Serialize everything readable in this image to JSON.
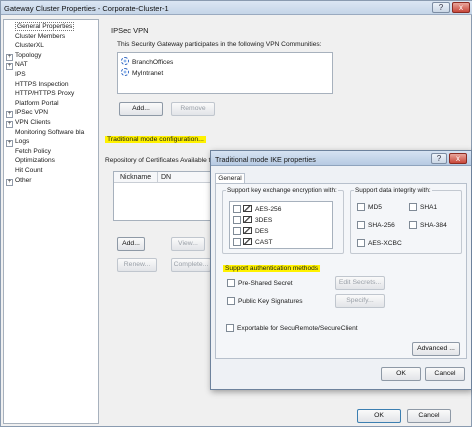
{
  "window": {
    "title": "Gateway Cluster Properties - Corporate-Cluster-1",
    "help": "?",
    "close": "x"
  },
  "tree": [
    {
      "label": "General Properties",
      "exp": "",
      "sel": true
    },
    {
      "label": "Cluster Members",
      "exp": ""
    },
    {
      "label": "ClusterXL",
      "exp": ""
    },
    {
      "label": "Topology",
      "exp": "+"
    },
    {
      "label": "NAT",
      "exp": "+"
    },
    {
      "label": "IPS",
      "exp": ""
    },
    {
      "label": "HTTPS Inspection",
      "exp": ""
    },
    {
      "label": "HTTP/HTTPS Proxy",
      "exp": ""
    },
    {
      "label": "Platform Portal",
      "exp": ""
    },
    {
      "label": "IPSec VPN",
      "exp": "+"
    },
    {
      "label": "VPN Clients",
      "exp": "+"
    },
    {
      "label": "Monitoring Software bla",
      "exp": ""
    },
    {
      "label": "Logs",
      "exp": "+"
    },
    {
      "label": "Fetch Policy",
      "exp": ""
    },
    {
      "label": "Optimizations",
      "exp": ""
    },
    {
      "label": "Hit Count",
      "exp": ""
    },
    {
      "label": "Other",
      "exp": "+"
    }
  ],
  "main": {
    "section_title": "IPSec VPN",
    "communities_label": "This Security Gateway participates in the following VPN Communities:",
    "communities": [
      "BranchOffices",
      "MyIntranet"
    ],
    "add": "Add...",
    "remove": "Remove",
    "traditional_link": "Traditional mode configuration...",
    "repo_label": "Repository of Certificates Available to",
    "columns": [
      "Nickname",
      "DN"
    ],
    "add2": "Add...",
    "view": "View...",
    "renew": "Renew...",
    "complete": "Complete...",
    "ok": "OK",
    "cancel": "Cancel"
  },
  "dialog": {
    "title": "Traditional mode IKE properties",
    "help": "?",
    "close": "x",
    "tab": "General",
    "enc_group": "Support key exchange encryption with:",
    "enc": [
      "AES-256",
      "3DES",
      "DES",
      "CAST"
    ],
    "integrity_group": "Support data integrity with:",
    "integrity": [
      "MD5",
      "SHA1",
      "SHA-256",
      "SHA-384",
      "AES-XCBC"
    ],
    "auth_group": "Support authentication methods",
    "pre_shared": "Pre-Shared Secret",
    "edit_secrets": "Edit Secrets...",
    "pki": "Public Key Signatures",
    "specify": "Specify...",
    "exportable": "Exportable for SecuRemote/SecureClient",
    "advanced": "Advanced ...",
    "ok": "OK",
    "cancel": "Cancel"
  }
}
